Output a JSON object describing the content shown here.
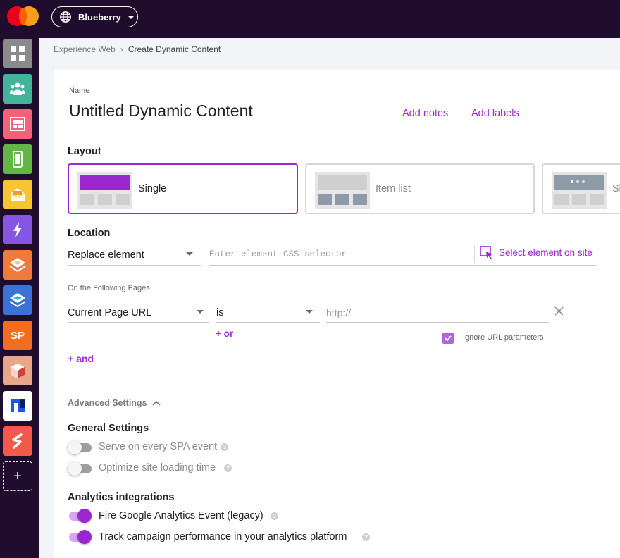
{
  "topbar": {
    "site_name": "Blueberry",
    "logo_icon": "mastercard-logo",
    "globe_icon": "globe-icon"
  },
  "sidebar": {
    "items": [
      {
        "icon": "dashboard-grid-icon",
        "color": "#8a8a8a"
      },
      {
        "icon": "audience-icon",
        "color": "#43b49a"
      },
      {
        "icon": "web-layout-icon",
        "color": "#f4627a"
      },
      {
        "icon": "mobile-icon",
        "color": "#63b548"
      },
      {
        "icon": "email-icon",
        "color": "#f7c530"
      },
      {
        "icon": "bolt-icon",
        "color": "#8456e3"
      },
      {
        "icon": "layers-orange-icon",
        "color": "#f07a3c"
      },
      {
        "icon": "layers-blue-icon",
        "color": "#3a72d6"
      },
      {
        "icon": "sp-icon",
        "label": "SP",
        "color": "#f36d20"
      },
      {
        "icon": "cube-icon",
        "color": "#e9a78a"
      },
      {
        "icon": "n-logo-icon",
        "color": "#1f57e5"
      },
      {
        "icon": "s-logo-icon",
        "color": "#f15a4a"
      },
      {
        "icon": "add-icon",
        "label": "+"
      }
    ]
  },
  "breadcrumb": {
    "parent": "Experience Web",
    "separator": "›",
    "current": "Create Dynamic Content"
  },
  "form": {
    "name_label": "Name",
    "name_value": "Untitled Dynamic Content",
    "add_notes": "Add notes",
    "add_labels": "Add labels",
    "layout_title": "Layout",
    "layouts": [
      {
        "label": "Single",
        "selected": true
      },
      {
        "label": "Item list",
        "selected": false
      },
      {
        "label": "Sl",
        "selected": false
      }
    ],
    "location_title": "Location",
    "location_mode": "Replace element",
    "css_selector_placeholder": "Enter element CSS selector",
    "select_element_link": "Select element on site",
    "pages_label": "On the Following Pages:",
    "page_condition_field": "Current Page URL",
    "page_condition_operator": "is",
    "url_placeholder": "http://",
    "or_link": "+ or",
    "ignore_params_label": "Ignore URL parameters",
    "ignore_params_checked": true,
    "and_link": "+ and",
    "advanced_settings": "Advanced Settings",
    "general_settings_title": "General Settings",
    "general_toggles": [
      {
        "label": "Serve on every SPA event",
        "on": false
      },
      {
        "label": "Optimize site loading time",
        "on": false
      }
    ],
    "analytics_title": "Analytics integrations",
    "analytics_toggles": [
      {
        "label": "Fire Google Analytics Event (legacy)",
        "on": true
      },
      {
        "label": "Track campaign performance in your analytics platform",
        "on": true
      }
    ]
  },
  "colors": {
    "accent": "#9b27d0",
    "topbar": "#200c2c"
  }
}
